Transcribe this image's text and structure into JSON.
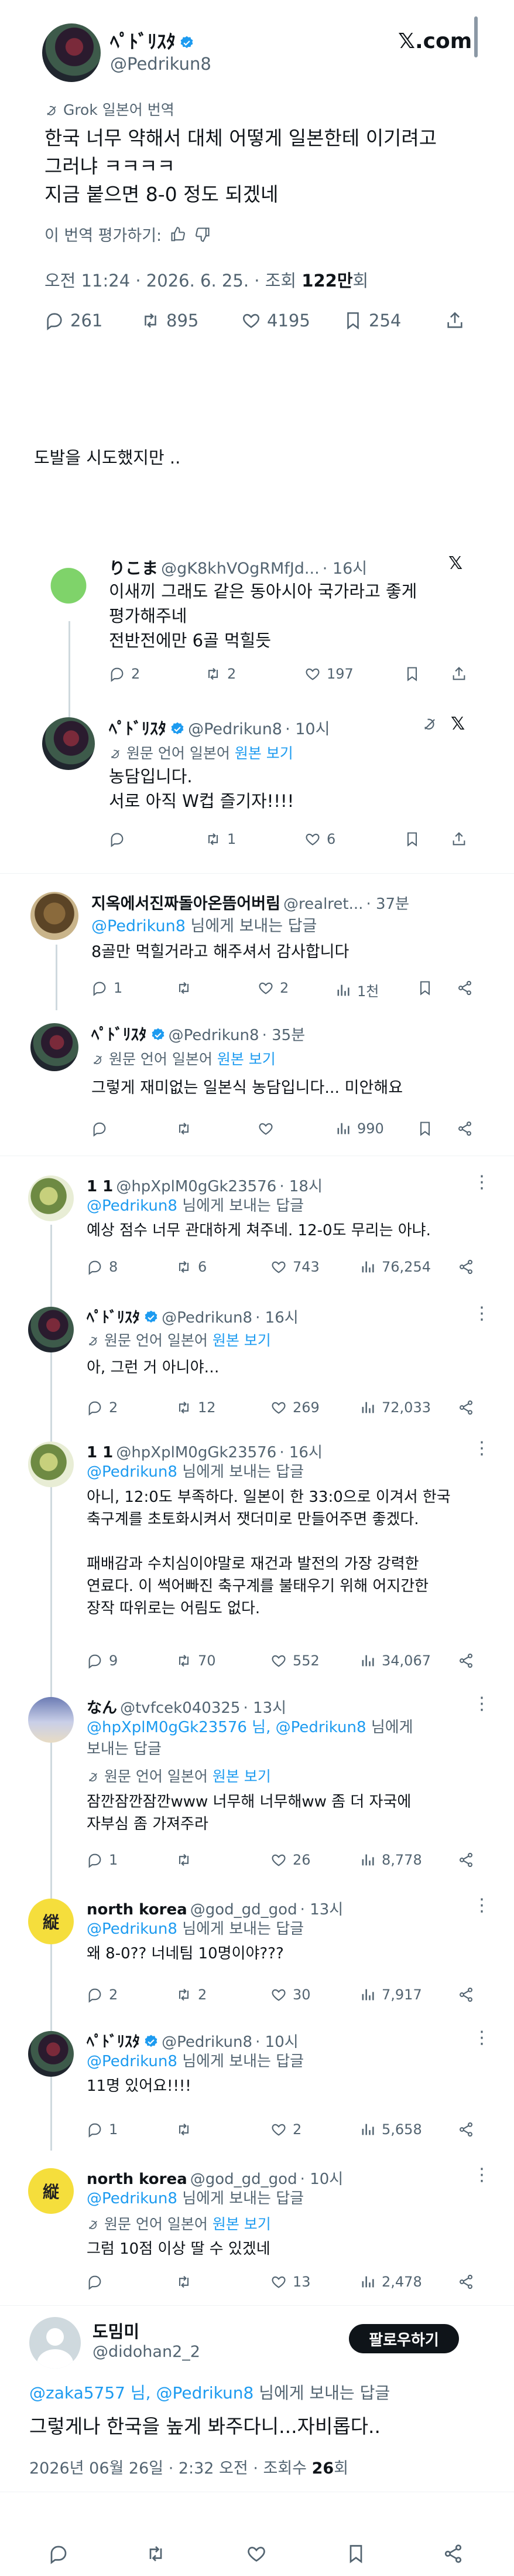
{
  "main_post": {
    "name": "ﾍﾟﾄﾞﾘｽﾀ",
    "handle": "@Pedrikun8",
    "site_label": "𝕏.com",
    "translation_notice": "Grok 일본어 번역",
    "text_lines": [
      "한국 너무 약해서 대체 어떻게 일본한테 이기려고",
      "그러냐 ㅋㅋㅋㅋ",
      "지금 붙으면 8-0 정도 되겠네"
    ],
    "rate_label": "이 번역 평가하기:",
    "timestamp": "오전 11:24 · 2026. 6. 25. · 조회",
    "views": "122만",
    "views_suffix": "회",
    "stats": {
      "replies": "261",
      "reposts": "895",
      "likes": "4195",
      "bookmarks": "254"
    }
  },
  "caption": "도발을 시도했지만 ..",
  "thread1": {
    "reply": {
      "name": "りこま",
      "handle": "@gK8khVOgRMfJd...",
      "time": "· 16시",
      "lines": [
        "이새끼 그래도 같은 동아시아 국가라고 좋게",
        "평가해주네",
        "전반전에만 6골 먹힐듯"
      ],
      "stats": {
        "replies": "2",
        "reposts": "2",
        "likes": "197"
      }
    },
    "answer": {
      "name": "ﾍﾟﾄﾞﾘｽﾀ",
      "handle": "@Pedrikun8",
      "time": "· 10시",
      "orig_lang": "원문 언어 일본어",
      "show_orig": "원본 보기",
      "lines": [
        "농담입니다.",
        "서로 아직 W컵 즐기자!!!!"
      ],
      "stats": {
        "reposts": "1",
        "likes": "6"
      }
    }
  },
  "thread2": {
    "reply": {
      "name": "지옥에서진짜돌아온뜸어버림",
      "handle": "@realret...",
      "time": "· 37분",
      "reply_to_handle": "@Pedrikun8",
      "reply_to_suffix": "님에게 보내는 답글",
      "text": "8골만 먹힐거라고 해주셔서 감사합니다",
      "stats": {
        "replies": "1",
        "likes": "2",
        "views": "1천"
      }
    },
    "answer": {
      "name": "ﾍﾟﾄﾞﾘｽﾀ",
      "handle": "@Pedrikun8",
      "time": "· 35분",
      "orig_lang": "원문 언어 일본어",
      "show_orig": "원본 보기",
      "text": "그렇게 재미없는 일본식 농담입니다... 미안해요",
      "stats": {
        "views": "990"
      }
    }
  },
  "thread3": [
    {
      "name": "1 1",
      "handle": "@hpXplM0gGk23576",
      "time": "· 18시",
      "reply_to_handle": "@Pedrikun8",
      "reply_to_suffix": "님에게 보내는 답글",
      "lines": [
        "예상 점수 너무 관대하게 쳐주네. 12-0도 무리는 아냐."
      ],
      "stats": {
        "replies": "8",
        "reposts": "6",
        "likes": "743",
        "views": "76,254"
      }
    },
    {
      "name": "ﾍﾟﾄﾞﾘｽﾀ",
      "handle": "@Pedrikun8",
      "time": "· 16시",
      "orig_lang": "원문 언어 일본어",
      "show_orig": "원본 보기",
      "lines": [
        "아, 그런 거 아니야…"
      ],
      "stats": {
        "replies": "2",
        "reposts": "12",
        "likes": "269",
        "views": "72,033"
      }
    },
    {
      "name": "1 1",
      "handle": "@hpXplM0gGk23576",
      "time": "· 16시",
      "reply_to_handle": "@Pedrikun8",
      "reply_to_suffix": "님에게 보내는 답글",
      "lines": [
        "아니, 12:0도 부족하다. 일본이 한 33:0으로 이겨서 한국",
        "축구계를 초토화시켜서 잿더미로 만들어주면 좋겠다.",
        "",
        "패배감과 수치심이야말로 재건과 발전의 가장 강력한",
        "연료다. 이 썩어빠진 축구계를 불태우기 위해 어지간한",
        "장작 따위로는 어림도 없다."
      ],
      "stats": {
        "replies": "9",
        "reposts": "70",
        "likes": "552",
        "views": "34,067"
      }
    },
    {
      "name": "なん",
      "handle": "@tvfcek040325",
      "time": "· 13시",
      "reply_to_handle": "@hpXplM0gGk23576 님, @Pedrikun8",
      "reply_to_suffix": "님에게",
      "reply_to_line2": "보내는 답글",
      "orig_lang": "원문 언어 일본어",
      "show_orig": "원본 보기",
      "lines": [
        "잠깐잠깐잠깐www 너무해 너무해ww 좀 더 자국에",
        "자부심 좀 가져주라"
      ],
      "stats": {
        "replies": "1",
        "likes": "26",
        "views": "8,778"
      }
    },
    {
      "name": "north korea",
      "handle": "@god_gd_god",
      "time": "· 13시",
      "avatar_char": "縦",
      "reply_to_handle": "@Pedrikun8",
      "reply_to_suffix": "님에게 보내는 답글",
      "lines": [
        "왜 8-0?? 너네팀 10명이야???"
      ],
      "stats": {
        "replies": "2",
        "reposts": "2",
        "likes": "30",
        "views": "7,917"
      }
    },
    {
      "name": "ﾍﾟﾄﾞﾘｽﾀ",
      "handle": "@Pedrikun8",
      "time": "· 10시",
      "reply_to_handle": "@Pedrikun8",
      "reply_to_suffix": "님에게 보내는 답글",
      "lines": [
        "11명 있어요!!!!"
      ],
      "stats": {
        "replies": "1",
        "likes": "2",
        "views": "5,658"
      }
    },
    {
      "name": "north korea",
      "handle": "@god_gd_god",
      "time": "· 10시",
      "avatar_char": "縦",
      "reply_to_handle": "@Pedrikun8",
      "reply_to_suffix": "님에게 보내는 답글",
      "orig_lang": "원문 언어 일본어",
      "show_orig": "원본 보기",
      "lines": [
        "그럼 10점 이상 딸 수 있겠네"
      ],
      "stats": {
        "likes": "13",
        "views": "2,478"
      }
    }
  ],
  "final_post": {
    "name": "도밈미",
    "handle": "@didohan2_2",
    "follow_label": "팔로우하기",
    "reply_to_handle": "@zaka5757 님, @Pedrikun8",
    "reply_to_suffix": "님에게 보내는 답글",
    "text": "그렇게나 한국을 높게 봐주다니...자비롭다..",
    "timestamp": "2026년 06월 26일 · 2:32 오전 · 조회수",
    "views": "26",
    "views_suffix": "회"
  },
  "colors": {
    "link": "#1d9bf0",
    "verified": "#1d9bf0",
    "text": "#0f1419",
    "muted": "#536471"
  }
}
